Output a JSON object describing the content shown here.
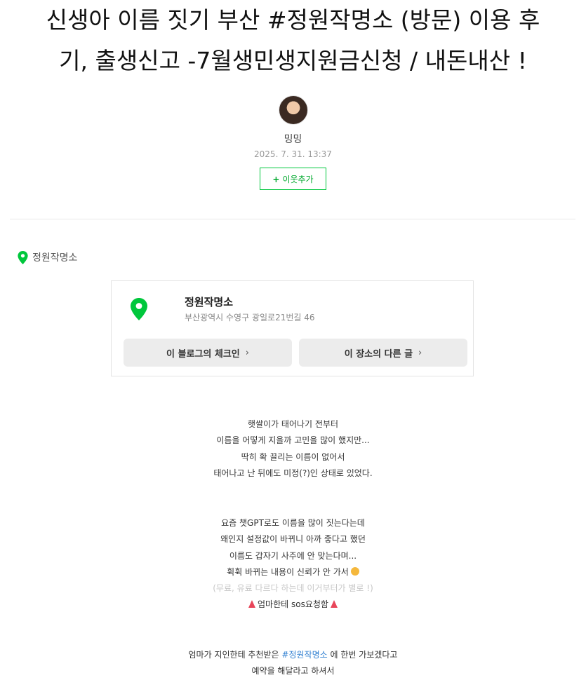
{
  "post": {
    "title_line1": "신생아 이름 짓기 부산 #정원작명소 (방문) 이용 후",
    "title_line2": "기, 출생신고 -7월생민생지원금신청 / 내돈내산 !"
  },
  "author": {
    "nickname": "밍밍",
    "date": "2025. 7. 31. 13:37",
    "follow_plus": "+",
    "follow_label": "이웃추가"
  },
  "place": {
    "label": "정원작명소",
    "name": "정원작명소",
    "address": "부산광역시 수영구 광일로21번길 46",
    "checkin_button": "이 블로그의 체크인",
    "other_posts_button": "이 장소의 다른 글",
    "chevron": "›"
  },
  "paragraph1": [
    "햇쌀이가 태어나기 전부터",
    "이름을 어떻게 지을까 고민을 많이 했지만...",
    "딱히 확 끌리는 이름이 없어서",
    "태어나고 난 뒤에도 미정(?)인 상태로 있었다."
  ],
  "paragraph2": [
    "요즘 챗GPT로도 이름을 많이 짓는다는데",
    "왜인지 설정값이 바뀌니 아까 좋다고 했던",
    "이름도 갑자기 사주에 안 맞는다며...",
    "휙휙 바뀌는 내용이 신뢰가 안 가서",
    "(무료, 유료 다르다 하는데 이거부터가 별로 !)",
    "엄마한테 sos요청함"
  ],
  "paragraph3": {
    "line1_before": "엄마가 지인한테 추천받은",
    "line1_hashtag": "#정원작명소",
    "line1_after": "에 한번 가보겠다고",
    "line2": "예약을 해달라고 하셔서"
  },
  "icons": {
    "pin": "map-pin-icon",
    "face": "flushed-face-emoji",
    "horn": "party-popper-emoji"
  },
  "colors": {
    "accent": "#00c73c",
    "hashtag": "#2f7fd1",
    "faint": "#c7c7c7"
  }
}
